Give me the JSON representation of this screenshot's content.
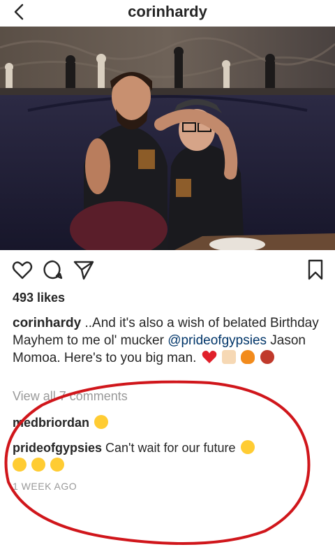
{
  "header": {
    "username": "corinhardy"
  },
  "post": {
    "likes": "493 likes",
    "caption_user": "corinhardy",
    "caption_part1": " ..And it's also a wish of belated Birthday Mayhem to me ol' mucker ",
    "caption_mention": "@prideofgypsies",
    "caption_part2": " Jason Momoa. Here's to you big man.",
    "view_all": "View all 7 comments",
    "time_ago": "1 WEEK AGO"
  },
  "comments": [
    {
      "user": "medbriordan",
      "text": ""
    },
    {
      "user": "prideofgypsies",
      "text": " Can't wait for our future"
    }
  ],
  "icons": [
    "back-icon",
    "heart-icon",
    "comment-icon",
    "share-icon",
    "bookmark-icon"
  ],
  "colors": {
    "annotation_oval": "#d0161b",
    "mention": "#003569",
    "muted": "#999999"
  }
}
